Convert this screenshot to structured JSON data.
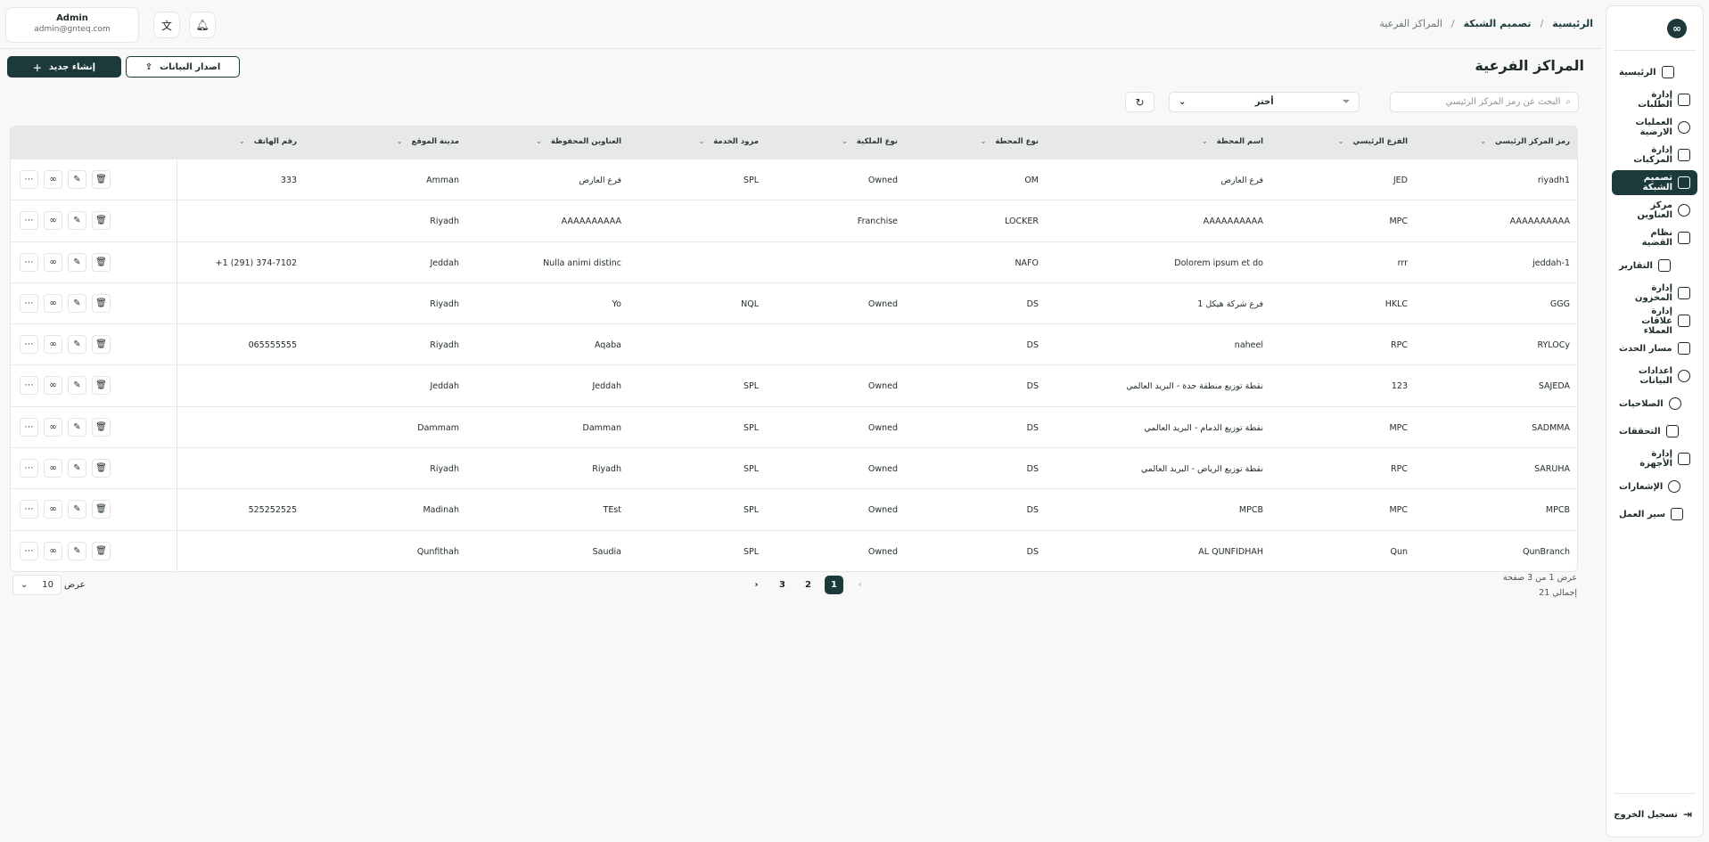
{
  "user": {
    "name": "Admin",
    "email": "admin@gnteq.com"
  },
  "breadcrumb": {
    "home": "الرئيسية",
    "section": "تصميم الشبكة",
    "current": "المراكز الفرعية"
  },
  "page": {
    "title": "المراكز الفرعية"
  },
  "toolbar": {
    "create_label": "إنشاء جديد",
    "export_label": "اصدار البيانات"
  },
  "filters": {
    "search_placeholder": "البحث عن رمز المركز الرئيسي",
    "select_value": "أختر"
  },
  "sidebar": {
    "logo": "∞",
    "items": [
      {
        "label": "الرئيسية",
        "active": false
      },
      {
        "label": "إدارة الطلبات",
        "active": false
      },
      {
        "label": "العمليات الارضية",
        "active": false
      },
      {
        "label": "إدارة المركبات",
        "active": false
      },
      {
        "label": "تصميم الشبكة",
        "active": true
      },
      {
        "label": "مركز العناوين",
        "active": false
      },
      {
        "label": "نظام القضية",
        "active": false
      },
      {
        "label": "التقارير",
        "active": false
      },
      {
        "label": "إدارة المخزون",
        "active": false
      },
      {
        "label": "إدارة علاقات العملاء",
        "active": false
      },
      {
        "label": "مسار الحدث",
        "active": false
      },
      {
        "label": "اعدادات البيانات",
        "active": false
      },
      {
        "label": "الصلاحيات",
        "active": false
      },
      {
        "label": "التحققات",
        "active": false
      },
      {
        "label": "إدارة الأجهزة",
        "active": false
      },
      {
        "label": "الإشعارات",
        "active": false
      },
      {
        "label": "سير العمل",
        "active": false
      }
    ],
    "logout_label": "تسجيل الخروج"
  },
  "table": {
    "headers": [
      "رمز المركز الرئيسي",
      "الفرع الرئيسي",
      "اسم المحطة",
      "نوع المحطة",
      "نوع الملكية",
      "مزود الخدمة",
      "العناوين المحفوظة",
      "مدينة الموقع",
      "رقم الهاتف"
    ],
    "rows": [
      [
        "riyadh1",
        "JED",
        "فرع العارض",
        "OM",
        "Owned",
        "SPL",
        "فرع العارض",
        "Amman",
        "333"
      ],
      [
        "AAAAAAAAAA",
        "MPC",
        "AAAAAAAAAA",
        "LOCKER",
        "Franchise",
        "",
        "AAAAAAAAAA",
        "Riyadh",
        ""
      ],
      [
        "jeddah-1",
        "rrr",
        "Dolorem ipsum et do",
        "NAFO",
        "",
        "",
        "Nulla animi distinc",
        "Jeddah",
        "+1 (291) 374-7102"
      ],
      [
        "GGG",
        "HKLC",
        "فرع شركة هيكل 1",
        "DS",
        "Owned",
        "NQL",
        "Yo",
        "Riyadh",
        ""
      ],
      [
        "RYLOCy",
        "RPC",
        "naheel",
        "DS",
        "",
        "",
        "Aqaba",
        "Riyadh",
        "065555555"
      ],
      [
        "SAJEDA",
        "123",
        "نقطة توزيع منطقة جدة - البريد العالمي",
        "DS",
        "Owned",
        "SPL",
        "Jeddah",
        "Jeddah",
        ""
      ],
      [
        "SADMMA",
        "MPC",
        "نقطة توزيع الدمام - البريد العالمي",
        "DS",
        "Owned",
        "SPL",
        "Damman",
        "Dammam",
        ""
      ],
      [
        "SARUHA",
        "RPC",
        "نقطة توزيع الرياض - البريد العالمي",
        "DS",
        "Owned",
        "SPL",
        "Riyadh",
        "Riyadh",
        ""
      ],
      [
        "MPCB",
        "MPC",
        "MPCB",
        "DS",
        "Owned",
        "SPL",
        "TEst",
        "Madinah",
        "525252525"
      ],
      [
        "QunBranch",
        "Qun",
        "AL QUNFIDHAH",
        "DS",
        "Owned",
        "SPL",
        "Saudia",
        "Qunfithah",
        ""
      ]
    ]
  },
  "pagination": {
    "pages": [
      "1",
      "2",
      "3"
    ],
    "active": "1",
    "info_line1": "عرض 1 من 3 صفحة",
    "info_line2": "إجمالي 21"
  },
  "page_size": {
    "value": "10",
    "label": "عرض"
  },
  "colors": {
    "primary": "#1c3a3a",
    "header_bg": "#e6e9e8",
    "page_bg": "#f7f8f7"
  }
}
